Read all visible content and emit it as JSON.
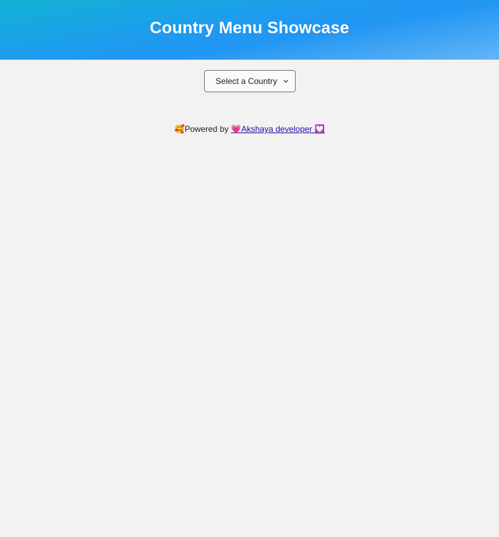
{
  "header": {
    "title": "Country Menu Showcase",
    "gradient": [
      "#12b2d4",
      "#2196f3",
      "#64b5f6"
    ]
  },
  "country_select": {
    "selected": "Select a Country",
    "icon": "chevron-down-icon"
  },
  "footer": {
    "emoji_prefix": "🥰",
    "powered_text": "Powered by ",
    "link_emoji_left": "💗",
    "link_text": "Akshaya developer ",
    "link_emoji_right": "💟",
    "link_color": "#1a0dab"
  },
  "colors": {
    "background": "#f2f2f2",
    "title_text": "#ffffff"
  }
}
